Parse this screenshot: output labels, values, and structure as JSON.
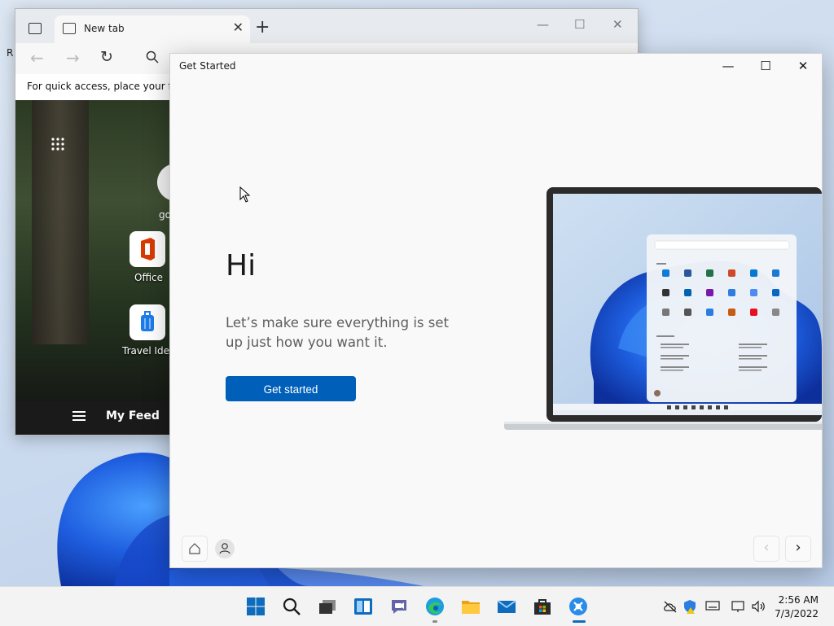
{
  "desktop": {
    "edge_text": "R"
  },
  "edge": {
    "tab_title": "New tab",
    "tab_close": "✕",
    "new_tab": "+",
    "minimize": "—",
    "maximize": "☐",
    "close": "✕",
    "favorites_hint": "For quick access, place your favo",
    "tile_go_label": "go",
    "tiles": [
      {
        "label": "Office",
        "icon": "office-icon"
      },
      {
        "label": "Travel Ideas",
        "icon": "travel-icon"
      }
    ],
    "feed_title": "My Feed"
  },
  "get_started": {
    "window_title": "Get Started",
    "minimize": "—",
    "maximize": "☐",
    "close": "✕",
    "heading": "Hi",
    "subtitle": "Let’s make sure everything is set up just how you want it.",
    "button": "Get started",
    "nav_prev": "‹",
    "nav_next": "›",
    "accent": "#005fb8"
  },
  "taskbar": {
    "apps": [
      "start-icon",
      "search-icon",
      "task-view-icon",
      "widgets-icon",
      "chat-icon",
      "edge-icon",
      "file-explorer-icon",
      "mail-icon",
      "store-icon",
      "get-started-icon"
    ],
    "time": "2:56 AM",
    "date": "7/3/2022"
  }
}
